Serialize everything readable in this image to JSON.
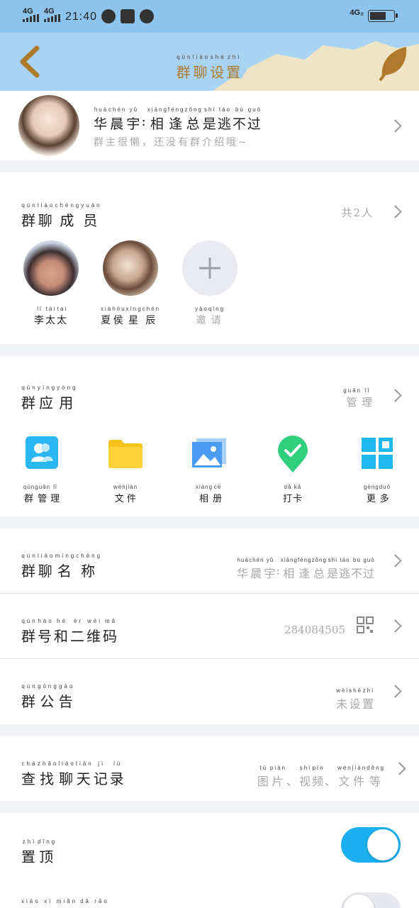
{
  "status_bar": {
    "signal1": "4G",
    "signal2": "4G",
    "time": "21:40",
    "net_right": "4G₂"
  },
  "header": {
    "title": "群聊设置",
    "title_pinyin": [
      "qún",
      "liáo",
      "shè",
      "zhì"
    ]
  },
  "group_profile": {
    "name": "华晨宇:相逢总是逃不过",
    "name_pinyin": [
      "huá",
      "chén",
      "yǔ",
      "",
      "xiāng",
      "féng",
      "zǒng",
      "shì",
      "táo",
      "bù",
      "guò"
    ],
    "intro": "群主很懒，还没有群介绍哦~"
  },
  "members": {
    "label": "群聊成员",
    "label_pinyin": [
      "qún",
      "liáo",
      "chéng",
      "yuán"
    ],
    "count": "共2人",
    "list": [
      {
        "name": "李太太",
        "pinyin": [
          "lǐ",
          "tài",
          "tai"
        ]
      },
      {
        "name": "夏侯星辰",
        "pinyin": [
          "xià",
          "hóu",
          "xīng",
          "chén"
        ]
      }
    ],
    "invite": "邀请"
  },
  "apps": {
    "label": "群应用",
    "label_pinyin": [
      "qún",
      "yìng",
      "yòng"
    ],
    "manage": "管理",
    "items": [
      {
        "label": "群管理",
        "icon": "group-manage-icon",
        "color": "#2ab6f0"
      },
      {
        "label": "文件",
        "icon": "folder-icon",
        "color": "#f8c21b"
      },
      {
        "label": "相册",
        "icon": "album-icon",
        "color": "#4a9cf2"
      },
      {
        "label": "打卡",
        "icon": "checkin-icon",
        "color": "#2fcf7b"
      },
      {
        "label": "更多",
        "icon": "more-grid-icon",
        "color": "#1fb8ee"
      }
    ]
  },
  "settings": {
    "group_name": {
      "label": "群聊名称",
      "value": "华晨宇:相逢总是逃不过"
    },
    "group_qr": {
      "label": "群号和二维码",
      "value": "284084505"
    },
    "notice": {
      "label": "群公告",
      "value": "未设置"
    },
    "search_chat": {
      "label": "查找聊天记录",
      "value": "图片、视频、文件等"
    },
    "pin_top": {
      "label": "置顶",
      "on": true
    },
    "next_row": {
      "label": "消息免打扰",
      "on": false
    }
  },
  "colors": {
    "accent": "#1bb0f0",
    "header_bg": "#a9d3f3",
    "status_bg": "#8dc4ee",
    "brown": "#b07a2c"
  }
}
